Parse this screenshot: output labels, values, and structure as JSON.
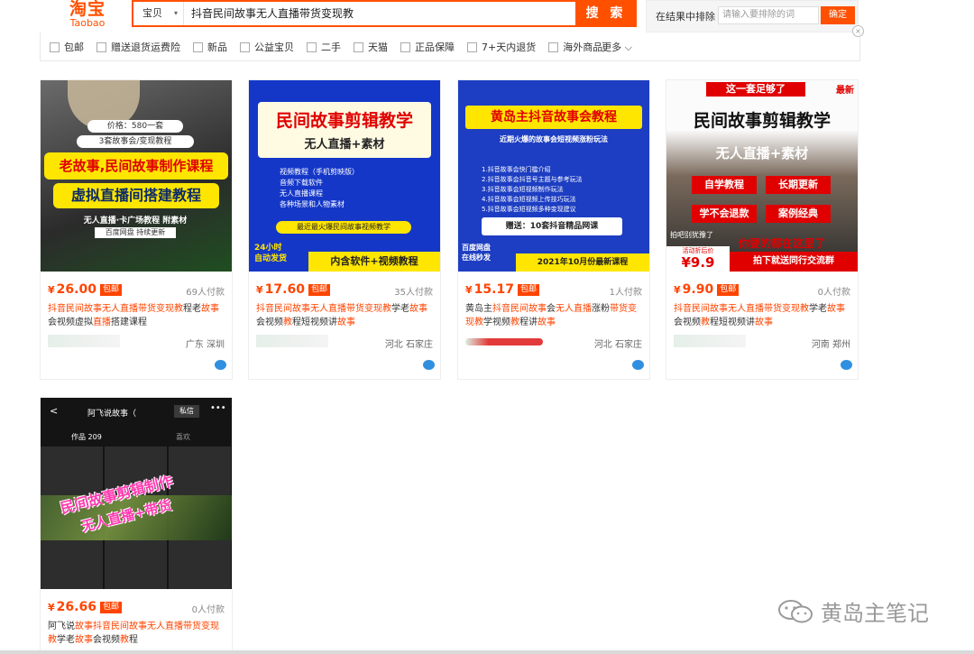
{
  "header": {
    "logo_cn": "淘宝",
    "logo_en": "Taobao",
    "search_scope": "宝贝",
    "search_query": "抖音民间故事无人直播带货变现教",
    "search_button": "搜 索",
    "exclude_label": "在结果中排除",
    "exclude_placeholder": "请输入要排除的词",
    "exclude_button": "确定"
  },
  "filters": [
    "包邮",
    "赠送退货运费险",
    "新品",
    "公益宝贝",
    "二手",
    "天猫",
    "正品保障",
    "7+天内退货",
    "海外商品"
  ],
  "more_label": "更多",
  "items": [
    {
      "price": "26.00",
      "badge": "包邮",
      "deals": "69人付款",
      "title_html": "<span class='hl'>抖音民间故事无人直播带货变现教</span>程老<span class='hl'>故事</span>会视频虚拟<span class='hl'>直播</span>搭建课程",
      "location": "广东 深圳",
      "img_texts": [
        "价格：580一套",
        "3套故事会/变现教程",
        "老故事,民间故事制作课程",
        "虚拟直播间搭建教程",
        "无人直播·卡广场教程 附素材",
        "百度网盘 持续更新"
      ]
    },
    {
      "price": "17.60",
      "badge": "包邮",
      "deals": "35人付款",
      "title_html": "<span class='hl'>抖音民间故事无人直播带货变现教</span>学老<span class='hl'>故事</span>会视频<span class='hl'>教</span>程短视频讲<span class='hl'>故事</span>",
      "location": "河北 石家庄",
      "img_texts": [
        "民间故事剪辑教学",
        "无人直播+素材",
        "视频教程（手机剪映版）",
        "音频下载软件",
        "无人直播课程",
        "各种场景和人物素材",
        "最近最火爆民间故事视频教学",
        "24小时",
        "自动发货",
        "内含软件+视频教程"
      ]
    },
    {
      "price": "15.17",
      "badge": "包邮",
      "deals": "1人付款",
      "title_html": "黄岛主<span class='hl'>抖音民间故事</span>会<span class='hl'>无人直播</span>涨粉<span class='hl'>带货变现教</span>学视频<span class='hl'>教</span>程讲<span class='hl'>故事</span>",
      "location": "河北 石家庄",
      "img_texts": [
        "黄岛主抖音故事会教程",
        "近期火爆的故事会短视频涨粉玩法",
        "1.抖音故事会快门槛介绍",
        "2.抖音故事会抖音号主题与参考玩法",
        "3.抖音故事会短视频制作玩法",
        "4.抖音故事会短视频上传技巧玩法",
        "5.抖音故事会短视频多种变现建议",
        "赠送：10套抖音精品网课",
        "百度网盘",
        "在线秒发",
        "2021年10月份最新课程"
      ]
    },
    {
      "price": "9.90",
      "badge": "包邮",
      "deals": "0人付款",
      "title_html": "<span class='hl'>抖音民间故事无人直播带货变现教</span>学老<span class='hl'>故事</span>会视频<span class='hl'>教</span>程短视频讲<span class='hl'>故事</span>",
      "location": "河南 郑州",
      "img_texts": [
        "这一套足够了",
        "最新",
        "民间故事剪辑教学",
        "无人直播+素材",
        "自学教程",
        "长期更新",
        "学不会退款",
        "案例经典",
        "拍吧别犹豫了",
        "你要的都在这里了",
        "活动折后价",
        "9.9",
        "拍下就送同行交流群"
      ]
    },
    {
      "price": "26.66",
      "badge": "包邮",
      "deals": "0人付款",
      "title_html": "阿飞说<span class='hl'>故事抖音民间故事无人直播带货变现教</span>学老<span class='hl'>故事</span>会视频<span class='hl'>教</span>程",
      "location": "",
      "img_texts": [
        "阿飞说故事（",
        "私信",
        "作品 209",
        "喜欢",
        "民间故事剪辑制作",
        "无人直播+带货"
      ]
    }
  ],
  "watermark": "黄岛主笔记",
  "icons": {
    "close": "close-icon",
    "caret": "chevron-down-icon",
    "chat": "wangwang-icon"
  }
}
